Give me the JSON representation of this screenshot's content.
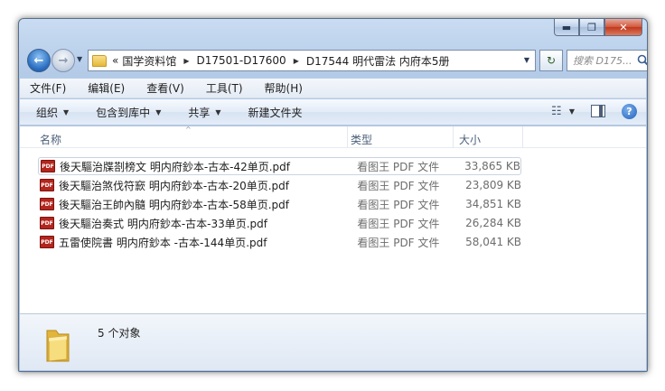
{
  "window": {
    "controls": {
      "minimize": "▬",
      "maximize": "❐",
      "close": "✕"
    }
  },
  "nav": {
    "back_glyph": "←",
    "forward_glyph": "→",
    "dropdown_glyph": "▼",
    "address_prefix": "«",
    "breadcrumbs": [
      "国学资料馆",
      "D17501-D17600",
      "D17544 明代雷法  内府本5册"
    ],
    "separator": "▶",
    "refresh_glyph": "↻",
    "search_placeholder": "搜索 D175..."
  },
  "menu": [
    "文件(F)",
    "编辑(E)",
    "查看(V)",
    "工具(T)",
    "帮助(H)"
  ],
  "commands": {
    "organize": "组织",
    "include_library": "包含到库中",
    "share": "共享",
    "new_folder": "新建文件夹",
    "arrow": "▼",
    "view_glyph": "☷",
    "help_glyph": "?"
  },
  "columns": {
    "name": "名称",
    "type": "类型",
    "size": "大小",
    "sort_glyph": "^"
  },
  "files": [
    {
      "name": "後天驅治牒剳榜文 明内府鈔本-古本-42单页.pdf",
      "type": "看图王 PDF 文件",
      "size": "33,865 KB"
    },
    {
      "name": "後天驅治煞伐符窾 明内府鈔本-古本-20单页.pdf",
      "type": "看图王 PDF 文件",
      "size": "23,809 KB"
    },
    {
      "name": "後天驅治王帥內髓 明内府鈔本-古本-58单页.pdf",
      "type": "看图王 PDF 文件",
      "size": "34,851 KB"
    },
    {
      "name": "後天驅治奏式 明内府鈔本-古本-33单页.pdf",
      "type": "看图王 PDF 文件",
      "size": "26,284 KB"
    },
    {
      "name": "五雷使院書 明内府鈔本 -古本-144单页.pdf",
      "type": "看图王 PDF 文件",
      "size": "58,041 KB"
    }
  ],
  "file_icon_label": "PDF",
  "details": {
    "count": "5 个对象"
  },
  "colors": {
    "accent": "#2a6fc1",
    "pdf_icon": "#b3261e",
    "close_button": "#c0391e"
  }
}
